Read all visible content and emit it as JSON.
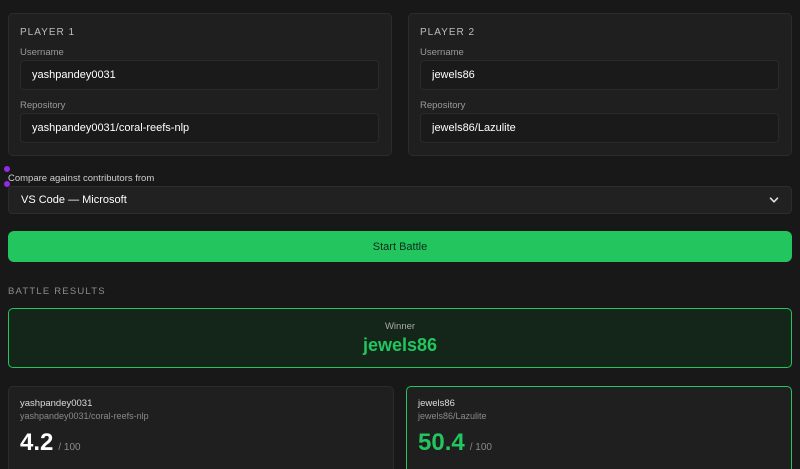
{
  "player1": {
    "title": "PLAYER 1",
    "username_label": "Username",
    "username_value": "yashpandey0031",
    "repo_label": "Repository",
    "repo_value": "yashpandey0031/coral-reefs-nlp"
  },
  "player2": {
    "title": "PLAYER 2",
    "username_label": "Username",
    "username_value": "jewels86",
    "repo_label": "Repository",
    "repo_value": "jewels86/Lazulite"
  },
  "compare": {
    "label": "Compare against contributors from",
    "selected": "VS Code — Microsoft"
  },
  "start_button": "Start Battle",
  "results": {
    "heading": "BATTLE RESULTS",
    "winner_label": "Winner",
    "winner_name": "jewels86",
    "cards": [
      {
        "user": "yashpandey0031",
        "repo": "yashpandey0031/coral-reefs-nlp",
        "score": "4.2",
        "out_of": "/ 100"
      },
      {
        "user": "jewels86",
        "repo": "jewels86/Lazulite",
        "score": "50.4",
        "out_of": "/ 100"
      }
    ]
  },
  "colors": {
    "accent": "#22c55e",
    "background": "#181818",
    "card": "#1f1f1f",
    "winner_bg": "#142619"
  },
  "icons": {
    "select_chevron": "chevron-down-icon"
  }
}
